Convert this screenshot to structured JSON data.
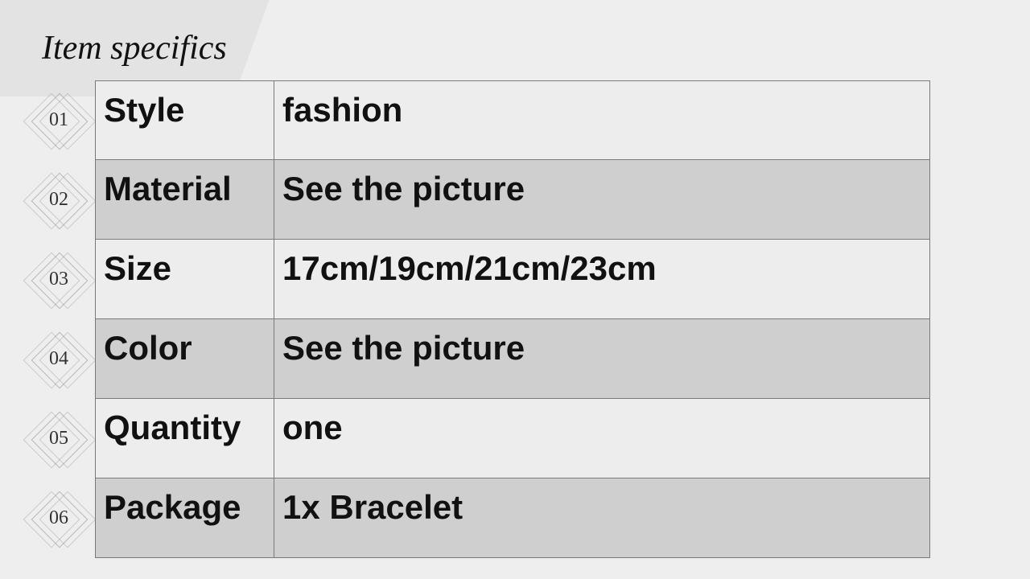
{
  "title": "Item specifics",
  "rows": [
    {
      "num": "01",
      "label": "Style",
      "value": "fashion"
    },
    {
      "num": "02",
      "label": "Material",
      "value": "See the picture"
    },
    {
      "num": "03",
      "label": "Size",
      "value": "17cm/19cm/21cm/23cm"
    },
    {
      "num": "04",
      "label": "Color",
      "value": "See the picture"
    },
    {
      "num": "05",
      "label": "Quantity",
      "value": "one"
    },
    {
      "num": "06",
      "label": "Package",
      "value": "1x Bracelet"
    }
  ]
}
